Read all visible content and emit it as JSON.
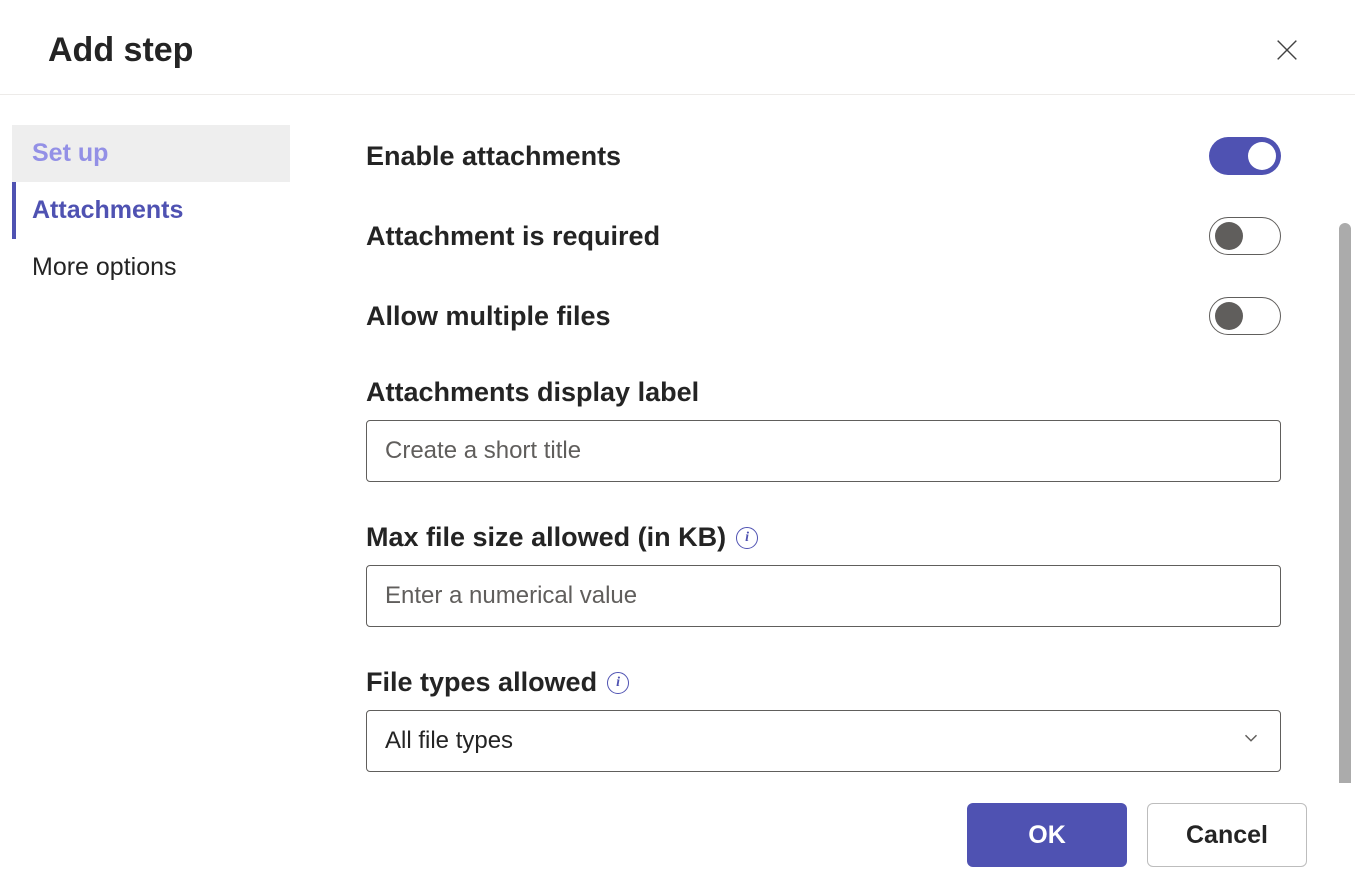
{
  "header": {
    "title": "Add step"
  },
  "sidebar": {
    "items": [
      {
        "label": "Set up",
        "state": "visited"
      },
      {
        "label": "Attachments",
        "state": "active"
      },
      {
        "label": "More options",
        "state": "default"
      }
    ]
  },
  "form": {
    "enable_attachments": {
      "label": "Enable attachments",
      "value": true
    },
    "attachment_required": {
      "label": "Attachment is required",
      "value": false
    },
    "allow_multiple": {
      "label": "Allow multiple files",
      "value": false
    },
    "display_label": {
      "label": "Attachments display label",
      "value": "",
      "placeholder": "Create a short title"
    },
    "max_file_size": {
      "label": "Max file size allowed (in KB)",
      "value": "",
      "placeholder": "Enter a numerical value"
    },
    "file_types": {
      "label": "File types allowed",
      "selected": "All file types"
    }
  },
  "footer": {
    "ok": "OK",
    "cancel": "Cancel"
  },
  "colors": {
    "accent": "#4f52b2"
  }
}
